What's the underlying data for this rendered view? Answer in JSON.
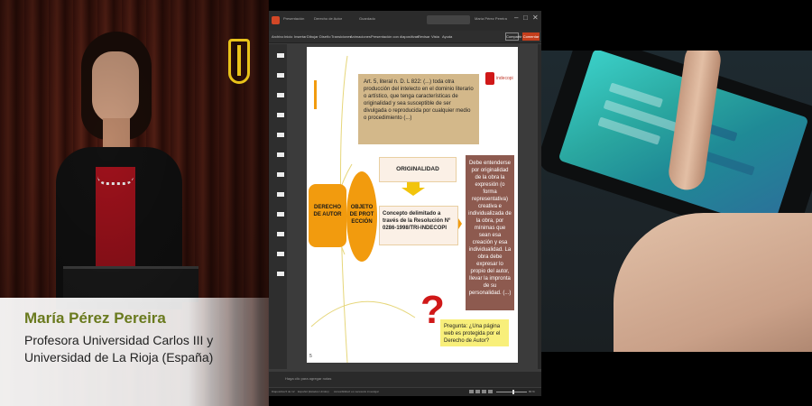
{
  "speaker": {
    "name": "María Pérez Pereira",
    "role": "Profesora Universidad Carlos III y Universidad de La Rioja (España)"
  },
  "powerpoint": {
    "titlebar": {
      "tabs": [
        "Presentación",
        "Derecho de Autor",
        "Guardado"
      ],
      "user": "María Pérez Pereira",
      "controls": [
        "–",
        "□",
        "✕"
      ]
    },
    "menu": [
      "Archivo",
      "Inicio",
      "Insertar",
      "Dibujar",
      "Diseño",
      "Transiciones",
      "Animaciones",
      "Presentación con diapositivas",
      "Revisar",
      "Vista",
      "Ayuda"
    ],
    "share_label": "Compartir",
    "comment_label": "Comentar",
    "notes_placeholder": "Haga clic para agregar notas",
    "status": {
      "slide_info": "Diapositiva 5 de 12",
      "language": "Español (Estados Unidos)",
      "accessibility": "Accesibilidad: es necesario investigar"
    },
    "zoom": "80 %",
    "slide": {
      "logo": "indecopi",
      "page_number": "5",
      "definition": "Art. 5, literal n. D. L 822: (...) toda otra producción del intelecto en el dominio literario o artístico, que tenga características de originalidad y sea susceptible de ser divulgada o reproducida  por cualquier medio o procedimiento (...)",
      "originalidad": "ORIGINALIDAD",
      "derecho": "DERECHO DE AUTOR",
      "objeto": "OBJETO DE PROTECCIÓN",
      "concepto": "Concepto delimitado a través de la Resolución N° 0286-1998/TRI-INDECOPI",
      "explanation": "Debe entenderse por originalidad de la obra la expresión (o forma representativa) creativa e individualizada de la obra, por mínimas que sean esa creación y esa individualidad. La obra debe expresar lo propio del autor, llevar la impronta de su personalidad. (...)",
      "question_mark": "?",
      "question": "Pregunta: ¿Una página web es protegida por el Derecho de Autor?"
    }
  },
  "colors": {
    "accent_orange": "#f29b0e",
    "brown": "#8d5a4f",
    "tan": "#d3b88a",
    "question_red": "#d01818",
    "lower_third_name": "#6a7a1e"
  }
}
